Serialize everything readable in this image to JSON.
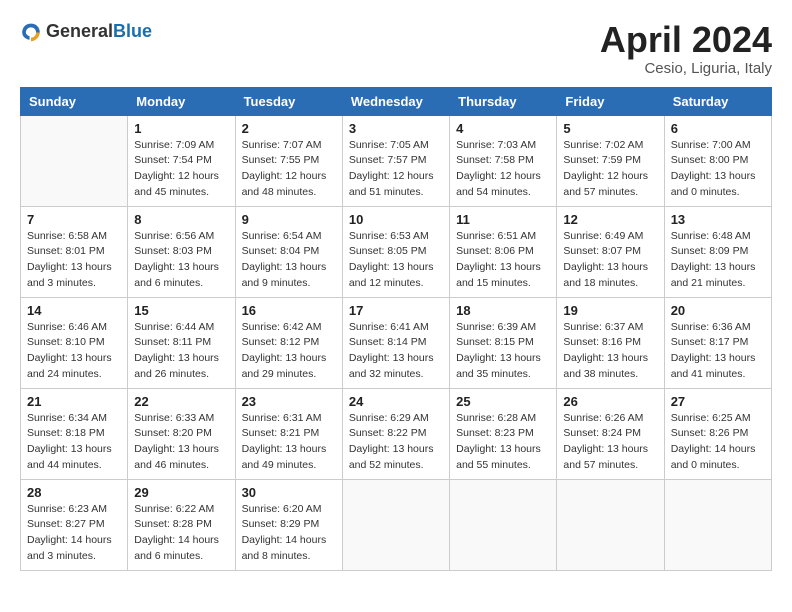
{
  "logo": {
    "general": "General",
    "blue": "Blue"
  },
  "title": "April 2024",
  "subtitle": "Cesio, Liguria, Italy",
  "headers": [
    "Sunday",
    "Monday",
    "Tuesday",
    "Wednesday",
    "Thursday",
    "Friday",
    "Saturday"
  ],
  "weeks": [
    [
      {
        "day": "",
        "info": ""
      },
      {
        "day": "1",
        "info": "Sunrise: 7:09 AM\nSunset: 7:54 PM\nDaylight: 12 hours\nand 45 minutes."
      },
      {
        "day": "2",
        "info": "Sunrise: 7:07 AM\nSunset: 7:55 PM\nDaylight: 12 hours\nand 48 minutes."
      },
      {
        "day": "3",
        "info": "Sunrise: 7:05 AM\nSunset: 7:57 PM\nDaylight: 12 hours\nand 51 minutes."
      },
      {
        "day": "4",
        "info": "Sunrise: 7:03 AM\nSunset: 7:58 PM\nDaylight: 12 hours\nand 54 minutes."
      },
      {
        "day": "5",
        "info": "Sunrise: 7:02 AM\nSunset: 7:59 PM\nDaylight: 12 hours\nand 57 minutes."
      },
      {
        "day": "6",
        "info": "Sunrise: 7:00 AM\nSunset: 8:00 PM\nDaylight: 13 hours\nand 0 minutes."
      }
    ],
    [
      {
        "day": "7",
        "info": "Sunrise: 6:58 AM\nSunset: 8:01 PM\nDaylight: 13 hours\nand 3 minutes."
      },
      {
        "day": "8",
        "info": "Sunrise: 6:56 AM\nSunset: 8:03 PM\nDaylight: 13 hours\nand 6 minutes."
      },
      {
        "day": "9",
        "info": "Sunrise: 6:54 AM\nSunset: 8:04 PM\nDaylight: 13 hours\nand 9 minutes."
      },
      {
        "day": "10",
        "info": "Sunrise: 6:53 AM\nSunset: 8:05 PM\nDaylight: 13 hours\nand 12 minutes."
      },
      {
        "day": "11",
        "info": "Sunrise: 6:51 AM\nSunset: 8:06 PM\nDaylight: 13 hours\nand 15 minutes."
      },
      {
        "day": "12",
        "info": "Sunrise: 6:49 AM\nSunset: 8:07 PM\nDaylight: 13 hours\nand 18 minutes."
      },
      {
        "day": "13",
        "info": "Sunrise: 6:48 AM\nSunset: 8:09 PM\nDaylight: 13 hours\nand 21 minutes."
      }
    ],
    [
      {
        "day": "14",
        "info": "Sunrise: 6:46 AM\nSunset: 8:10 PM\nDaylight: 13 hours\nand 24 minutes."
      },
      {
        "day": "15",
        "info": "Sunrise: 6:44 AM\nSunset: 8:11 PM\nDaylight: 13 hours\nand 26 minutes."
      },
      {
        "day": "16",
        "info": "Sunrise: 6:42 AM\nSunset: 8:12 PM\nDaylight: 13 hours\nand 29 minutes."
      },
      {
        "day": "17",
        "info": "Sunrise: 6:41 AM\nSunset: 8:14 PM\nDaylight: 13 hours\nand 32 minutes."
      },
      {
        "day": "18",
        "info": "Sunrise: 6:39 AM\nSunset: 8:15 PM\nDaylight: 13 hours\nand 35 minutes."
      },
      {
        "day": "19",
        "info": "Sunrise: 6:37 AM\nSunset: 8:16 PM\nDaylight: 13 hours\nand 38 minutes."
      },
      {
        "day": "20",
        "info": "Sunrise: 6:36 AM\nSunset: 8:17 PM\nDaylight: 13 hours\nand 41 minutes."
      }
    ],
    [
      {
        "day": "21",
        "info": "Sunrise: 6:34 AM\nSunset: 8:18 PM\nDaylight: 13 hours\nand 44 minutes."
      },
      {
        "day": "22",
        "info": "Sunrise: 6:33 AM\nSunset: 8:20 PM\nDaylight: 13 hours\nand 46 minutes."
      },
      {
        "day": "23",
        "info": "Sunrise: 6:31 AM\nSunset: 8:21 PM\nDaylight: 13 hours\nand 49 minutes."
      },
      {
        "day": "24",
        "info": "Sunrise: 6:29 AM\nSunset: 8:22 PM\nDaylight: 13 hours\nand 52 minutes."
      },
      {
        "day": "25",
        "info": "Sunrise: 6:28 AM\nSunset: 8:23 PM\nDaylight: 13 hours\nand 55 minutes."
      },
      {
        "day": "26",
        "info": "Sunrise: 6:26 AM\nSunset: 8:24 PM\nDaylight: 13 hours\nand 57 minutes."
      },
      {
        "day": "27",
        "info": "Sunrise: 6:25 AM\nSunset: 8:26 PM\nDaylight: 14 hours\nand 0 minutes."
      }
    ],
    [
      {
        "day": "28",
        "info": "Sunrise: 6:23 AM\nSunset: 8:27 PM\nDaylight: 14 hours\nand 3 minutes."
      },
      {
        "day": "29",
        "info": "Sunrise: 6:22 AM\nSunset: 8:28 PM\nDaylight: 14 hours\nand 6 minutes."
      },
      {
        "day": "30",
        "info": "Sunrise: 6:20 AM\nSunset: 8:29 PM\nDaylight: 14 hours\nand 8 minutes."
      },
      {
        "day": "",
        "info": ""
      },
      {
        "day": "",
        "info": ""
      },
      {
        "day": "",
        "info": ""
      },
      {
        "day": "",
        "info": ""
      }
    ]
  ]
}
